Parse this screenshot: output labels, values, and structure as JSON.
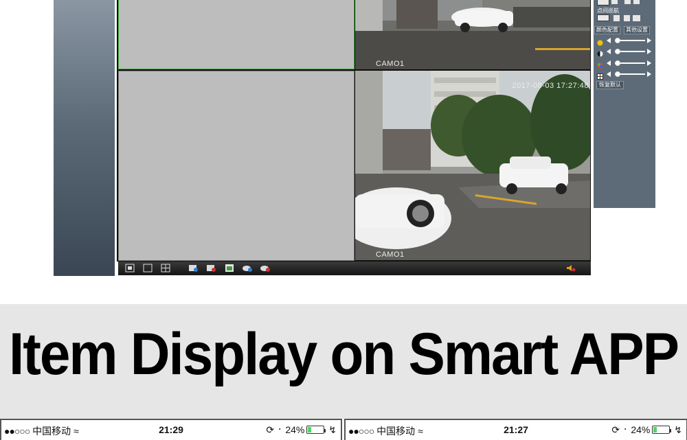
{
  "dvr": {
    "cameras": [
      {
        "label": "",
        "timestamp": ""
      },
      {
        "label": "CAMO1",
        "timestamp": ""
      },
      {
        "label": "",
        "timestamp": ""
      },
      {
        "label": "CAMO1",
        "timestamp": "2017-08-03 17:27:48"
      }
    ],
    "right_panel": {
      "cruise_label": "点间巡航",
      "tab_color": "颜色配置",
      "tab_other": "其他设置",
      "reset_label": "恢复默认",
      "sliders": [
        {
          "icon": "brightness-icon",
          "level": 0.05
        },
        {
          "icon": "contrast-icon",
          "level": 0.05
        },
        {
          "icon": "saturation-icon",
          "level": 0.05
        },
        {
          "icon": "hue-icon",
          "level": 0.05
        }
      ]
    },
    "toolbar_icons": [
      "fullscreen-icon",
      "single-view-icon",
      "quad-view-icon",
      "record-icon",
      "stop-record-icon",
      "snapshot-icon",
      "talk-icon",
      "stop-talk-icon",
      "volume-icon"
    ],
    "colors": {
      "active_border": "#3bb33b",
      "panel": "#5d6b78"
    }
  },
  "headline": "Item Display on Smart APP",
  "phones": [
    {
      "carrier": "中国移动",
      "time": "21:29",
      "battery": "24%",
      "battery_level": 0.24
    },
    {
      "carrier": "中国移动",
      "time": "21:27",
      "battery": "24%",
      "battery_level": 0.24
    }
  ]
}
